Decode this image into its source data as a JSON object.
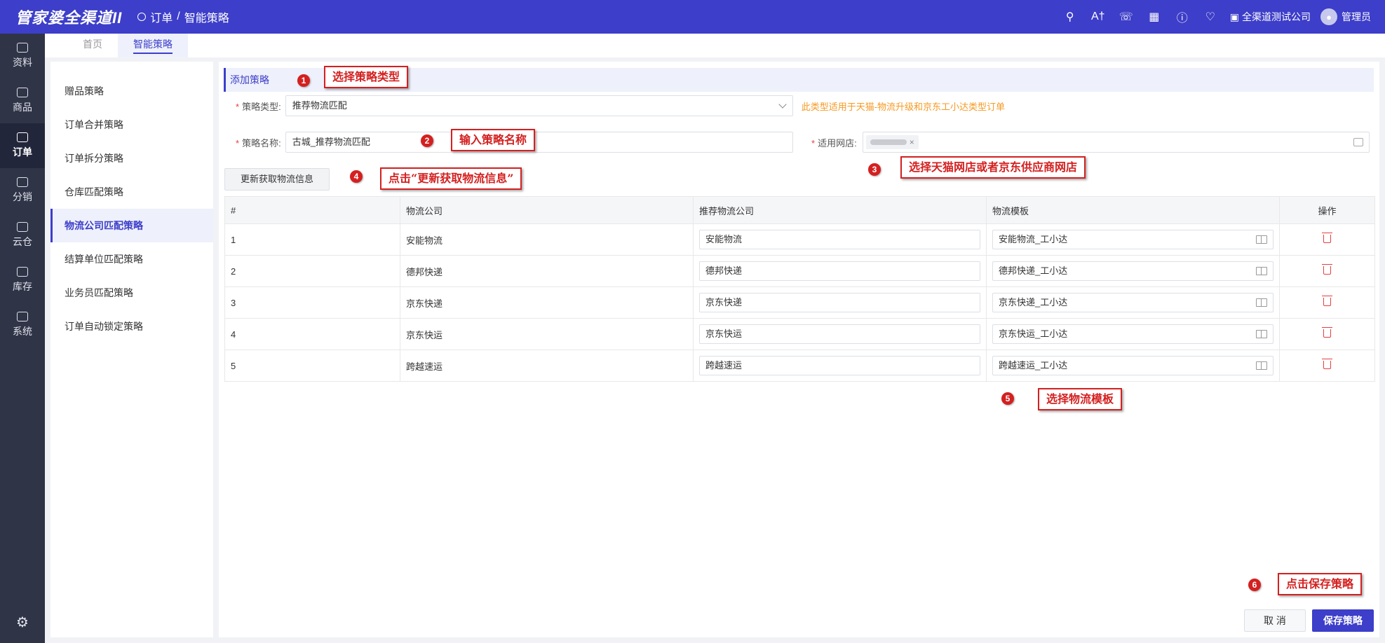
{
  "topbar": {
    "logo": "管家婆全渠道II",
    "breadcrumb": [
      "订单",
      "/",
      "智能策略"
    ],
    "icons": [
      "search-icon",
      "ai-icon",
      "headset-icon",
      "book-icon",
      "help-icon",
      "bell-icon"
    ],
    "company": "全渠道测试公司",
    "user": "管理员"
  },
  "leftnav": [
    {
      "label": "资料",
      "icon": "layers-icon"
    },
    {
      "label": "商品",
      "icon": "box-icon"
    },
    {
      "label": "订单",
      "icon": "order-icon",
      "active": true
    },
    {
      "label": "分销",
      "icon": "network-icon"
    },
    {
      "label": "云仓",
      "icon": "warehouse-icon"
    },
    {
      "label": "库存",
      "icon": "stock-icon"
    },
    {
      "label": "系统",
      "icon": "monitor-icon"
    }
  ],
  "tabs": [
    {
      "label": "首页"
    },
    {
      "label": "智能策略",
      "active": true
    }
  ],
  "subnav": [
    {
      "label": "赠品策略"
    },
    {
      "label": "订单合并策略"
    },
    {
      "label": "订单拆分策略"
    },
    {
      "label": "仓库匹配策略"
    },
    {
      "label": "物流公司匹配策略",
      "active": true
    },
    {
      "label": "结算单位匹配策略"
    },
    {
      "label": "业务员匹配策略"
    },
    {
      "label": "订单自动锁定策略"
    }
  ],
  "form": {
    "section_title": "添加策略",
    "type_label": "策略类型:",
    "type_value": "推荐物流匹配",
    "type_hint": "此类型适用于天猫-物流升级和京东工小达类型订单",
    "name_label": "策略名称:",
    "name_value": "古城_推荐物流匹配",
    "shop_label": "适用网店:",
    "shop_tag_close": "×",
    "refresh_button": "更新获取物流信息"
  },
  "table": {
    "headers": [
      "#",
      "物流公司",
      "推荐物流公司",
      "物流模板",
      "操作"
    ],
    "rows": [
      {
        "index": "1",
        "company": "安能物流",
        "recommended": "安能物流",
        "template": "安能物流_工小达"
      },
      {
        "index": "2",
        "company": "德邦快递",
        "recommended": "德邦快递",
        "template": "德邦快递_工小达"
      },
      {
        "index": "3",
        "company": "京东快递",
        "recommended": "京东快递",
        "template": "京东快递_工小达"
      },
      {
        "index": "4",
        "company": "京东快运",
        "recommended": "京东快运",
        "template": "京东快运_工小达"
      },
      {
        "index": "5",
        "company": "跨越速运",
        "recommended": "跨越速运",
        "template": "跨越速运_工小达"
      }
    ]
  },
  "footer": {
    "cancel": "取 消",
    "save": "保存策略"
  },
  "annotations": [
    {
      "num": "1",
      "text": "选择策略类型"
    },
    {
      "num": "2",
      "text": "输入策略名称"
    },
    {
      "num": "3",
      "text": "选择天猫网店或者京东供应商网店"
    },
    {
      "num": "4",
      "text": "点击“更新获取物流信息”"
    },
    {
      "num": "5",
      "text": "选择物流模板"
    },
    {
      "num": "6",
      "text": "点击保存策略"
    }
  ],
  "colors": {
    "brand": "#3d3ec9",
    "nav_bg": "#2f3447",
    "annotation": "#d42020",
    "hint": "#f59a23"
  }
}
